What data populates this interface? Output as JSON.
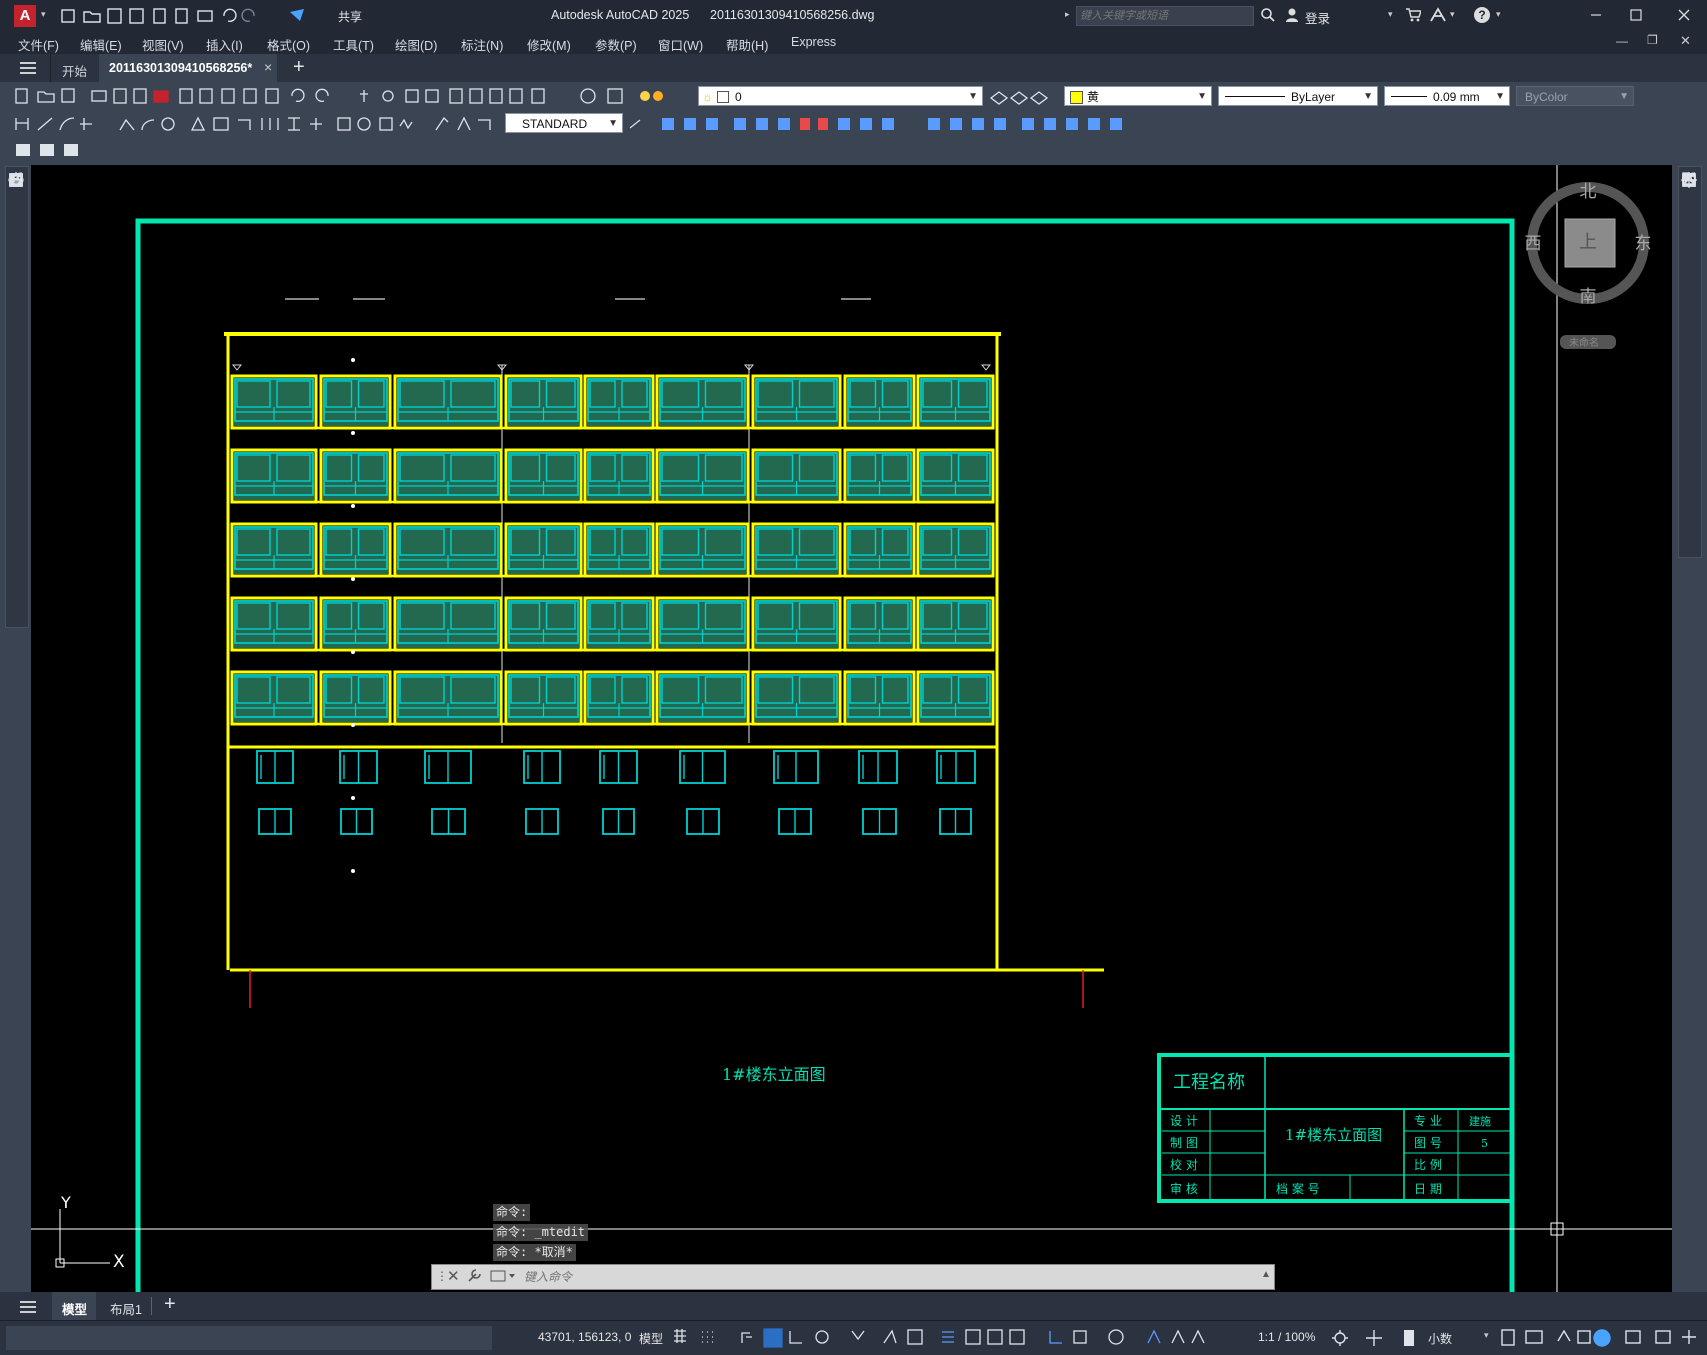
{
  "app": {
    "title": "Autodesk AutoCAD 2025",
    "filename": "20116301309410568256.dwg",
    "search_placeholder": "键入关键字或短语",
    "login": "登录",
    "share": "共享"
  },
  "menu": [
    "文件(F)",
    "编辑(E)",
    "视图(V)",
    "插入(I)",
    "格式(O)",
    "工具(T)",
    "绘图(D)",
    "标注(N)",
    "修改(M)",
    "参数(P)",
    "窗口(W)",
    "帮助(H)",
    "Express"
  ],
  "tabs": {
    "start": "开始",
    "active": "20116301309410568256*",
    "close": "×",
    "add": "+"
  },
  "properties": {
    "layer": "0",
    "color": "黄",
    "linetype": "ByLayer",
    "lineweight": "0.09 mm",
    "plotstyle": "ByColor",
    "textstyle": "STANDARD"
  },
  "viewcube": {
    "north": "北",
    "south": "南",
    "east": "东",
    "west": "西",
    "top": "上",
    "wcs": "未命名"
  },
  "drawing": {
    "caption": "1#楼东立面图",
    "title_block": {
      "project_name": "工程名称",
      "drawing_name": "1#楼东立面图",
      "design": "设 计",
      "drafting": "制 图",
      "checking": "校 对",
      "review": "审 核",
      "archive_no": "档 案 号",
      "discipline_label": "专 业",
      "discipline_value": "建施",
      "sheet_label": "图 号",
      "sheet_value": "5",
      "scale_label": "比 例",
      "date_label": "日 期"
    },
    "ucs_x": "X",
    "ucs_y": "Y"
  },
  "command": {
    "history": [
      "命令:",
      "命令: _mtedit",
      "命令: *取消*"
    ],
    "placeholder": "键入命令"
  },
  "layout_tabs": [
    "模型",
    "布局1"
  ],
  "status": {
    "coords": "43701, 156123, 0",
    "model": "模型",
    "scale": "1:1 / 100%",
    "units": "小数"
  },
  "colors": {
    "frame": "#00e8b0",
    "building": "#ffff00",
    "window": "#00d0d0",
    "glass": "#3fbf8f",
    "text_cyan": "#00e0b0"
  }
}
